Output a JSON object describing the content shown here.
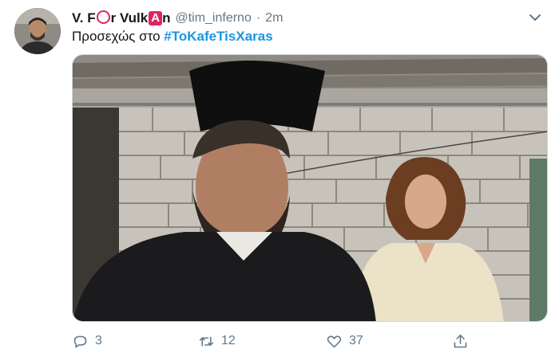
{
  "tweet": {
    "author_name_part1": "V. F",
    "author_name_part2": "r Vulk",
    "author_name_badge": "A",
    "author_name_part3": "n",
    "handle": "@tim_inferno",
    "separator": "·",
    "time": "2m",
    "text": "Προσεχώς στο",
    "hashtag": "#ToKafeTisXaras"
  },
  "actions": {
    "reply_count": "3",
    "retweet_count": "12",
    "like_count": "37"
  },
  "icons": {
    "avatar": "avatar-icon",
    "menu": "chevron-down-icon",
    "reply": "reply-icon",
    "retweet": "retweet-icon",
    "like": "heart-icon",
    "share": "share-icon"
  },
  "colors": {
    "accent": "#1b95e0",
    "badge": "#e0245e",
    "muted": "#657786"
  }
}
